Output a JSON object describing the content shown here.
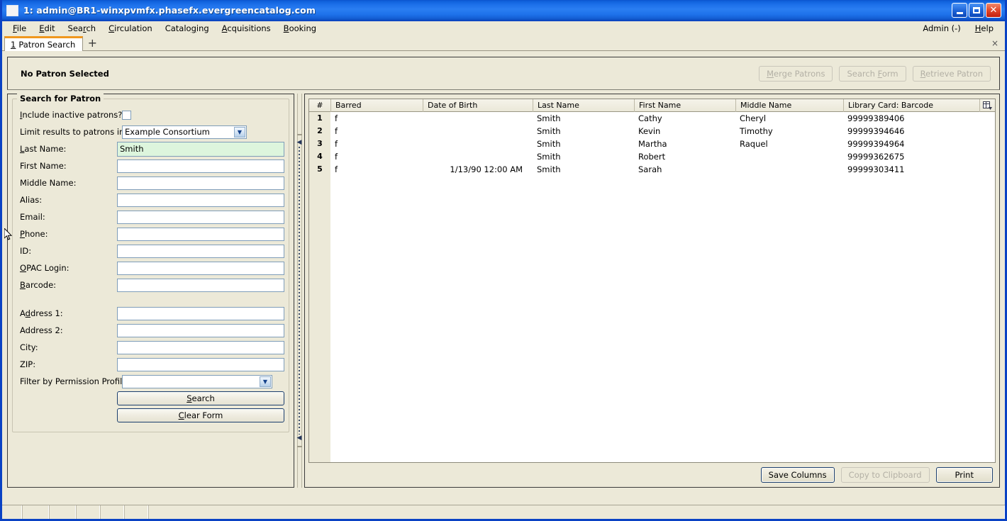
{
  "window": {
    "title": "1: admin@BR1-winxpvmfx.phasefx.evergreencatalog.com",
    "minimize_label": "Minimize",
    "maximize_label": "Maximize",
    "close_label": "Close"
  },
  "menubar": {
    "items": [
      {
        "label": "File",
        "accesskey": "F"
      },
      {
        "label": "Edit",
        "accesskey": "E"
      },
      {
        "label": "Search",
        "accesskey": "r"
      },
      {
        "label": "Circulation",
        "accesskey": "C"
      },
      {
        "label": "Cataloging",
        "accesskey": "g"
      },
      {
        "label": "Acquisitions",
        "accesskey": "A"
      },
      {
        "label": "Booking",
        "accesskey": "B"
      }
    ],
    "right": [
      {
        "label": "Admin (-)",
        "accesskey": ""
      },
      {
        "label": "Help",
        "accesskey": "H"
      }
    ]
  },
  "tabbar": {
    "tabs": [
      {
        "number": "1",
        "label": "Patron Search",
        "active": true
      }
    ],
    "new_tab_label": "+",
    "close_label": "×"
  },
  "patron_header": {
    "title": "No Patron Selected",
    "buttons": [
      {
        "label": "Merge Patrons",
        "accesskey": "M",
        "enabled": false
      },
      {
        "label": "Search Form",
        "accesskey": "F",
        "enabled": false
      },
      {
        "label": "Retrieve Patron",
        "accesskey": "R",
        "enabled": false
      }
    ]
  },
  "search_form": {
    "legend": "Search for Patron",
    "fields": {
      "include_inactive": {
        "label": "Include inactive patrons?",
        "accesskey": "I",
        "checked": false
      },
      "limit_results": {
        "label": "Limit results to patrons in",
        "value": "Example Consortium"
      },
      "last_name": {
        "label": "Last Name:",
        "accesskey": "L",
        "value": "Smith",
        "focused": true
      },
      "first_name": {
        "label": "First Name:",
        "value": ""
      },
      "middle_name": {
        "label": "Middle Name:",
        "value": ""
      },
      "alias": {
        "label": "Alias:",
        "value": ""
      },
      "email": {
        "label": "Email:",
        "value": ""
      },
      "phone": {
        "label": "Phone:",
        "accesskey": "P",
        "value": ""
      },
      "id": {
        "label": "ID:",
        "value": ""
      },
      "opac_login": {
        "label": "OPAC Login:",
        "accesskey": "O",
        "value": ""
      },
      "barcode": {
        "label": "Barcode:",
        "accesskey": "B",
        "value": ""
      },
      "address1": {
        "label": "Address 1:",
        "accesskey": "d",
        "value": ""
      },
      "address2": {
        "label": "Address 2:",
        "value": ""
      },
      "city": {
        "label": "City:",
        "value": ""
      },
      "zip": {
        "label": "ZIP:",
        "value": ""
      },
      "permission_profile": {
        "label": "Filter by Permission Profile:",
        "value": ""
      }
    },
    "buttons": {
      "search": {
        "label": "Search",
        "accesskey": "S"
      },
      "clear": {
        "label": "Clear Form",
        "accesskey": "C"
      }
    }
  },
  "results": {
    "columns": [
      "#",
      "Barred",
      "Date of Birth",
      "Last Name",
      "First Name",
      "Middle Name",
      "Library Card: Barcode"
    ],
    "column_picker_label": "Column picker",
    "rows": [
      {
        "num": "1",
        "barred": "f",
        "dob": "",
        "last": "Smith",
        "first": "Cathy",
        "middle": "Cheryl",
        "barcode": "99999389406"
      },
      {
        "num": "2",
        "barred": "f",
        "dob": "",
        "last": "Smith",
        "first": "Kevin",
        "middle": "Timothy",
        "barcode": "99999394646"
      },
      {
        "num": "3",
        "barred": "f",
        "dob": "",
        "last": "Smith",
        "first": "Martha",
        "middle": "Raquel",
        "barcode": "99999394964"
      },
      {
        "num": "4",
        "barred": "f",
        "dob": "",
        "last": "Smith",
        "first": "Robert",
        "middle": "",
        "barcode": "99999362675"
      },
      {
        "num": "5",
        "barred": "f",
        "dob": "1/13/90 12:00 AM",
        "last": "Smith",
        "first": "Sarah",
        "middle": "",
        "barcode": "99999303411"
      }
    ],
    "footer_buttons": [
      {
        "label": "Save Columns",
        "enabled": true
      },
      {
        "label": "Copy to Clipboard",
        "enabled": false
      },
      {
        "label": "Print",
        "enabled": true
      }
    ]
  },
  "statusbar": {
    "cells": [
      "",
      "",
      "",
      "",
      "",
      "",
      ""
    ]
  },
  "colors": {
    "title_bar": "#1b6ee8",
    "window_bg": "#ece9d8",
    "active_tab_accent": "#f0971e",
    "focused_field_bg": "#ddf5dd",
    "field_border": "#7f9db9"
  }
}
